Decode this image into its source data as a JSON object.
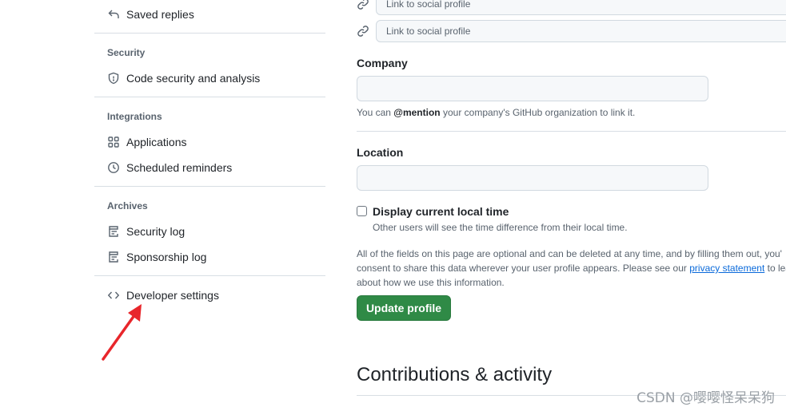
{
  "sidebar": {
    "saved_replies": "Saved replies",
    "security_heading": "Security",
    "code_security": "Code security and analysis",
    "integrations_heading": "Integrations",
    "applications": "Applications",
    "scheduled_reminders": "Scheduled reminders",
    "archives_heading": "Archives",
    "security_log": "Security log",
    "sponsorship_log": "Sponsorship log",
    "developer_settings": "Developer settings"
  },
  "profile": {
    "social_placeholder_1": "Link to social profile",
    "social_placeholder_2": "Link to social profile",
    "company_label": "Company",
    "company_value": "",
    "company_hint_pre": "You can ",
    "company_hint_mention": "@mention",
    "company_hint_post": " your company's GitHub organization to link it.",
    "location_label": "Location",
    "location_value": "",
    "local_time_label": "Display current local time",
    "local_time_checked": false,
    "local_time_hint": "Other users will see the time difference from their local time.",
    "note_line1": "All of the fields on this page are optional and can be deleted at any time, and by filling them out, you'",
    "note_line2_pre": "consent to share this data wherever your user profile appears. Please see our ",
    "note_link": "privacy statement",
    "note_line2_post": " to lear",
    "note_line3": "about how we use this information.",
    "update_button": "Update profile"
  },
  "contributions_title": "Contributions & activity",
  "watermark": "CSDN @嘤嘤怪呆呆狗",
  "colors": {
    "primary_button": "#2f8a46",
    "link": "#0969da",
    "annotation_arrow": "#e8262b"
  }
}
